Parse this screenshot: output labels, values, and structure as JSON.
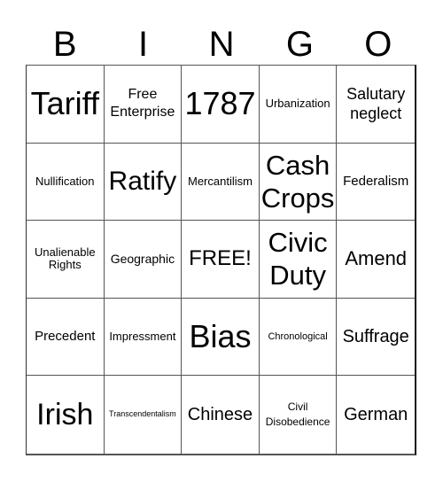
{
  "header": {
    "letters": [
      "B",
      "I",
      "N",
      "G",
      "O"
    ]
  },
  "grid": {
    "rows": [
      [
        "Tariff",
        "Free Enterprise",
        "1787",
        "Urbanization",
        "Salutary neglect"
      ],
      [
        "Nullification",
        "Ratify",
        "Mercantilism",
        "Cash Crops",
        "Federalism"
      ],
      [
        "Unalienable Rights",
        "Geographic",
        "FREE!",
        "Civic Duty",
        "Amend"
      ],
      [
        "Precedent",
        "Impressment",
        "Bias",
        "Chronological",
        "Suffrage"
      ],
      [
        "Irish",
        "Transcendentalism",
        "Chinese",
        "Civil Disobedience",
        "German"
      ]
    ]
  }
}
